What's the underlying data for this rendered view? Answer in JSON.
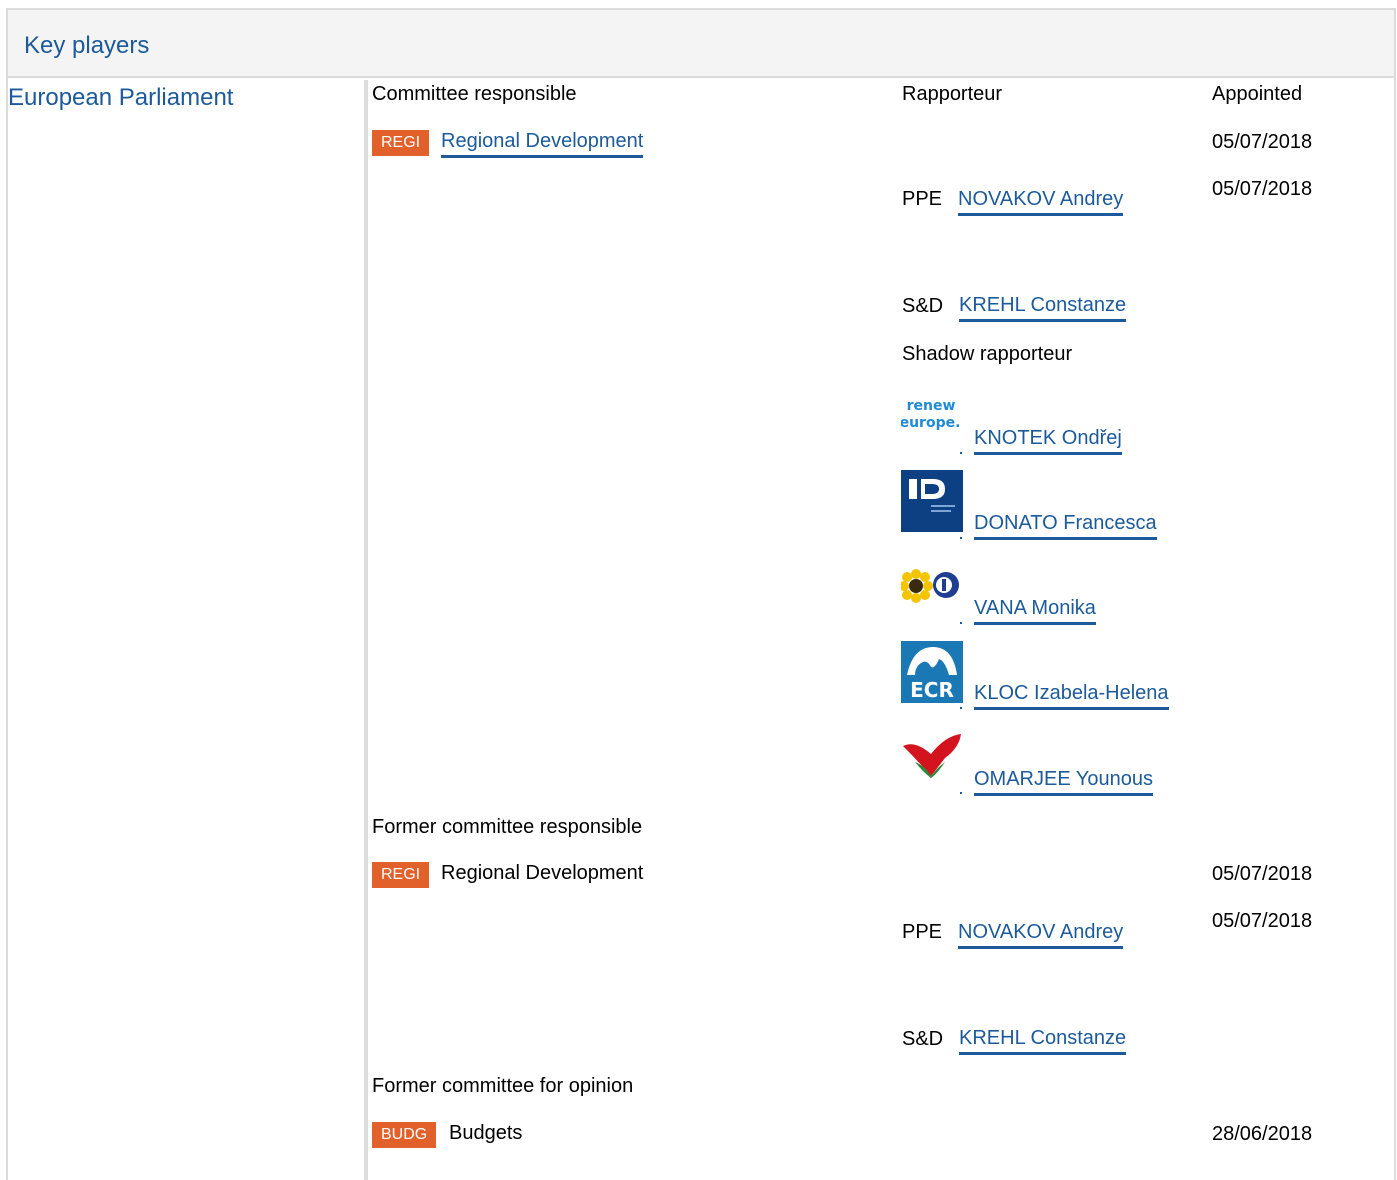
{
  "header": {
    "title": "Key players"
  },
  "institution": "European Parliament",
  "columns": {
    "committee": "Committee responsible",
    "rapporteur": "Rapporteur",
    "appointed": "Appointed"
  },
  "committee_responsible": {
    "code": "REGI",
    "name": "Regional Development",
    "appointed": "05/07/2018",
    "rapporteurs": [
      {
        "group": "PPE",
        "name": "NOVAKOV Andrey",
        "appointed": "05/07/2018"
      },
      {
        "group": "S&D",
        "name": "KREHL Constanze"
      }
    ],
    "shadow_label": "Shadow rapporteur",
    "shadows": [
      {
        "logo": "renew-europe-logo",
        "logo_text_1": "renew",
        "logo_text_2": "europe.",
        "name": "KNOTEK Ondřej"
      },
      {
        "logo": "id-group-logo",
        "name": "DONATO Francesca"
      },
      {
        "logo": "greens-efa-logo",
        "name": "VANA Monika"
      },
      {
        "logo": "ecr-logo",
        "logo_text": "ECR",
        "name": "KLOC Izabela-Helena"
      },
      {
        "logo": "gue-ngl-logo",
        "name": "OMARJEE Younous"
      }
    ]
  },
  "former_committee": {
    "label": "Former committee responsible",
    "code": "REGI",
    "name": "Regional Development",
    "appointed": "05/07/2018",
    "rapporteurs": [
      {
        "group": "PPE",
        "name": "NOVAKOV Andrey",
        "appointed": "05/07/2018"
      },
      {
        "group": "S&D",
        "name": "KREHL Constanze"
      }
    ]
  },
  "former_opinion": {
    "label": "Former committee for opinion",
    "code": "BUDG",
    "name": "Budgets",
    "appointed": "28/06/2018"
  },
  "colors": {
    "link": "#1c5a9b",
    "badge": "#e2612b",
    "border": "#dcdcdc",
    "header_bg": "#f4f4f4"
  }
}
